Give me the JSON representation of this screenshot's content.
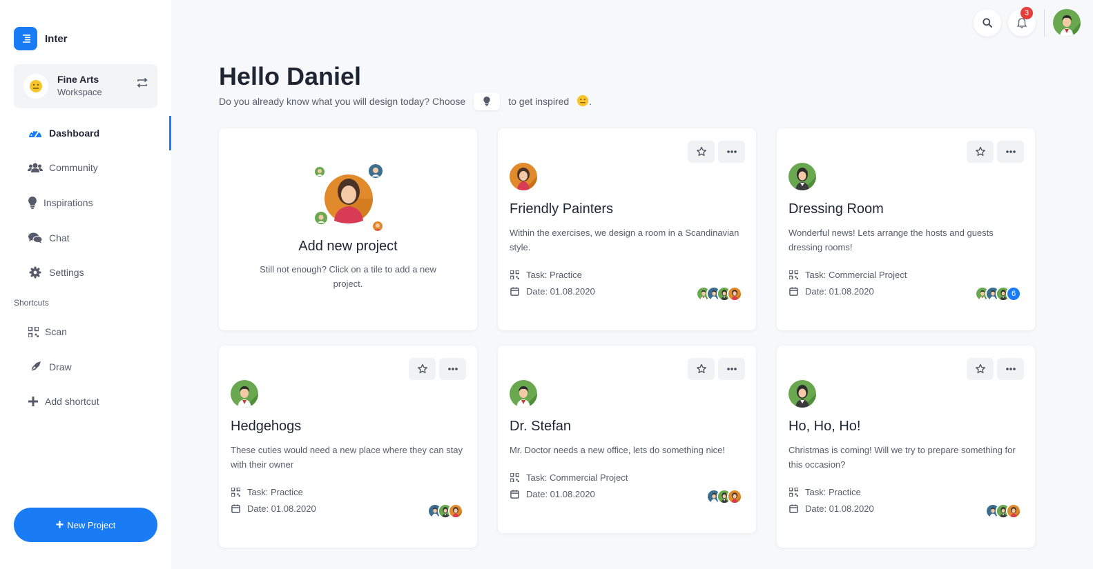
{
  "app": {
    "name": "Inter"
  },
  "workspace": {
    "title": "Fine Arts",
    "subtitle": "Workspace"
  },
  "nav": {
    "items": [
      {
        "label": "Dashboard",
        "icon": "dashboard-gauge-icon",
        "active": true
      },
      {
        "label": "Community",
        "icon": "users-icon",
        "active": false
      },
      {
        "label": "Inspirations",
        "icon": "lightbulb-icon",
        "active": false
      },
      {
        "label": "Chat",
        "icon": "chat-bubbles-icon",
        "active": false
      },
      {
        "label": "Settings",
        "icon": "gear-icon",
        "active": false
      }
    ],
    "shortcuts_label": "Shortcuts",
    "shortcuts": [
      {
        "label": "Scan",
        "icon": "qr-code-icon"
      },
      {
        "label": "Draw",
        "icon": "pen-nib-icon"
      },
      {
        "label": "Add shortcut",
        "icon": "plus-icon"
      }
    ],
    "new_project_label": "New Project"
  },
  "header": {
    "notifications_count": "3"
  },
  "greeting": {
    "title": "Hello Daniel",
    "subtitle_before": "Do you already know what you will design today? Choose",
    "subtitle_after": "to get inspired",
    "subtitle_end": "."
  },
  "add_card": {
    "title": "Add new project",
    "description": "Still not enough? Click on a tile to add a new project."
  },
  "colors": {
    "accent": "#1a7cf5",
    "badge": "#e53c3c"
  },
  "projects": [
    {
      "title": "Friendly Painters",
      "description": "Within the exercises, we design a room in a Scandinavian style.",
      "task": "Task: Practice",
      "date": "Date: 01.08.2020",
      "extra_members": ""
    },
    {
      "title": "Dressing Room",
      "description": "Wonderful news! Lets arrange the hosts and guests dressing rooms!",
      "task": "Task: Commercial Project",
      "date": "Date: 01.08.2020",
      "extra_members": "6"
    },
    {
      "title": "Hedgehogs",
      "description": "These cuties would need a new place where they can stay with their owner",
      "task": "Task: Practice",
      "date": "Date: 01.08.2020",
      "extra_members": ""
    },
    {
      "title": "Dr. Stefan",
      "description": "Mr. Doctor needs a new office, lets do something nice!",
      "task": "Task: Commercial Project",
      "date": "Date: 01.08.2020",
      "extra_members": ""
    },
    {
      "title": "Ho, Ho, Ho!",
      "description": "Christmas is coming! Will we try to prepare something for this occasion?",
      "task": "Task: Practice",
      "date": "Date: 01.08.2020",
      "extra_members": ""
    }
  ]
}
